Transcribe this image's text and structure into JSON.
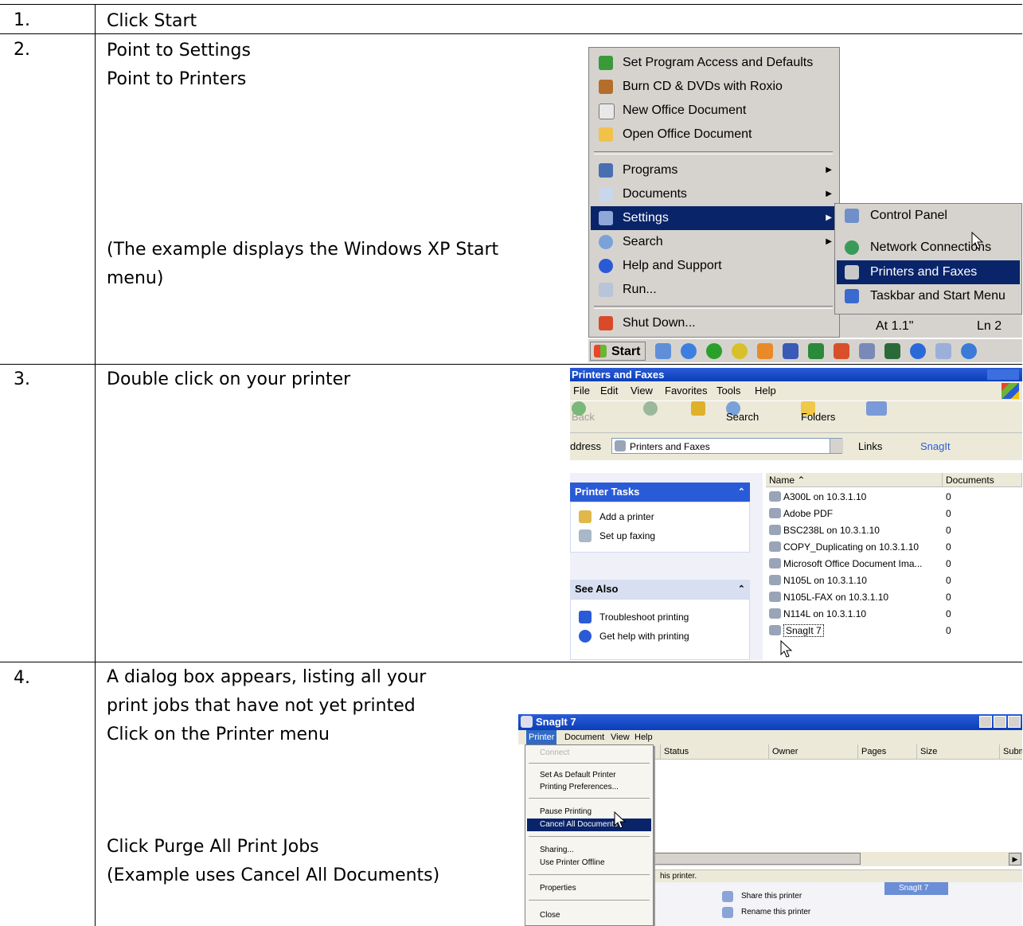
{
  "steps": [
    {
      "num": "1.",
      "lines": [
        "Click Start"
      ]
    },
    {
      "num": "2.",
      "lines": [
        "Point to Settings",
        "Point to Printers"
      ],
      "note": [
        "(The example displays the Windows XP Start",
        "menu)"
      ]
    },
    {
      "num": "3.",
      "lines": [
        "Double click on your printer"
      ]
    },
    {
      "num": "4.",
      "lines": [
        "A dialog box appears, listing all your",
        "print jobs that have not yet printed",
        "Click on the Printer menu"
      ],
      "extra": [
        "Click Purge All Print Jobs",
        "(Example uses Cancel All Documents)"
      ]
    }
  ],
  "start_menu": {
    "items": [
      {
        "label": "Set Program Access and Defaults",
        "icon": "program-access-icon"
      },
      {
        "label": "Burn CD & DVDs with Roxio",
        "icon": "roxio-icon"
      },
      {
        "label": "New Office Document",
        "icon": "new-office-doc-icon"
      },
      {
        "label": "Open Office Document",
        "icon": "open-office-doc-icon"
      },
      {
        "label": "Programs",
        "icon": "programs-icon"
      },
      {
        "label": "Documents",
        "icon": "documents-icon"
      },
      {
        "label": "Settings",
        "icon": "settings-icon"
      },
      {
        "label": "Search",
        "icon": "search-icon"
      },
      {
        "label": "Help and Support",
        "icon": "help-icon"
      },
      {
        "label": "Run...",
        "icon": "run-icon"
      },
      {
        "label": "Shut Down...",
        "icon": "shutdown-icon"
      }
    ],
    "settings_submenu": [
      {
        "label": "Control Panel",
        "icon": "control-panel-icon"
      },
      {
        "label": "Network Connections",
        "icon": "network-connections-icon"
      },
      {
        "label": "Printers and Faxes",
        "icon": "printers-faxes-icon"
      },
      {
        "label": "Taskbar and Start Menu",
        "icon": "taskbar-start-icon"
      }
    ],
    "behind_text": {
      "position": "At 1.1\"",
      "line": "Ln 2"
    },
    "start_label": "Start"
  },
  "printers_window": {
    "title": "Printers and Faxes",
    "menu": [
      "File",
      "Edit",
      "View",
      "Favorites",
      "Tools",
      "Help"
    ],
    "toolbar": {
      "back": "Back",
      "search": "Search",
      "folders": "Folders"
    },
    "address_label": "ddress",
    "address_value": "Printers and Faxes",
    "links_label": "Links",
    "snagit_label": "SnagIt",
    "tasks_header": "Printer Tasks",
    "tasks": [
      "Add a printer",
      "Set up faxing"
    ],
    "see_also_header": "See Also",
    "see_also": [
      "Troubleshoot printing",
      "Get help with printing"
    ],
    "col_name": "Name",
    "col_docs": "Documents",
    "printers": [
      {
        "name": "A300L on 10.3.1.10",
        "docs": "0"
      },
      {
        "name": "Adobe PDF",
        "docs": "0"
      },
      {
        "name": "BSC238L on 10.3.1.10",
        "docs": "0"
      },
      {
        "name": "COPY_Duplicating on 10.3.1.10",
        "docs": "0"
      },
      {
        "name": "Microsoft Office Document Ima...",
        "docs": "0"
      },
      {
        "name": "N105L on 10.3.1.10",
        "docs": "0"
      },
      {
        "name": "N105L-FAX on 10.3.1.10",
        "docs": "0"
      },
      {
        "name": "N114L on 10.3.1.10",
        "docs": "0"
      },
      {
        "name": "SnagIt 7",
        "docs": "0"
      }
    ]
  },
  "snagit_window": {
    "title": "SnagIt 7",
    "menu": [
      "Printer",
      "Document",
      "View",
      "Help"
    ],
    "columns": [
      "Status",
      "Owner",
      "Pages",
      "Size",
      "Subm"
    ],
    "printer_menu": [
      {
        "label": "Connect",
        "disabled": true
      },
      {
        "label": "Set As Default Printer"
      },
      {
        "label": "Printing Preferences..."
      },
      {
        "label": "Pause Printing"
      },
      {
        "label": "Cancel All Documents",
        "selected": true
      },
      {
        "label": "Sharing..."
      },
      {
        "label": "Use Printer Offline"
      },
      {
        "label": "Properties"
      },
      {
        "label": "Close"
      }
    ],
    "status_text": "his printer.",
    "tasks": [
      "Share this printer",
      "Rename this printer"
    ],
    "thumb_label": "SnagIt 7"
  }
}
